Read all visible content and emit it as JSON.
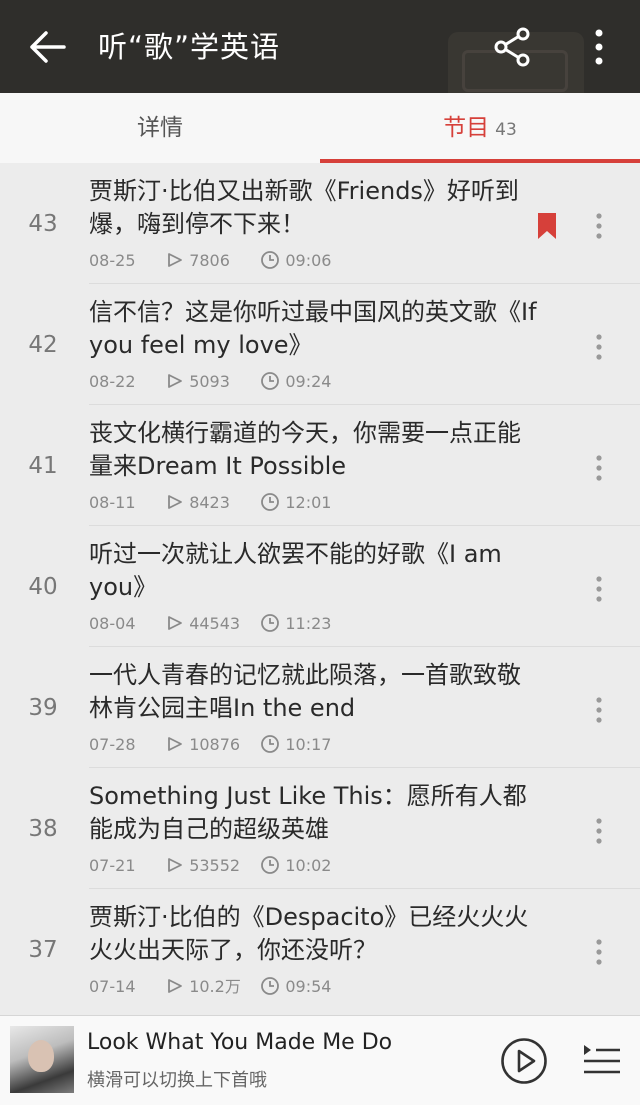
{
  "header": {
    "title": "听“歌”学英语",
    "back_icon": "arrow-left-icon",
    "share_icon": "share-icon",
    "more_icon": "more-vertical-icon"
  },
  "tabs": [
    {
      "label": "详情",
      "count": "",
      "active": false
    },
    {
      "label": "节目",
      "count": "43",
      "active": true
    }
  ],
  "episodes": [
    {
      "num": "43",
      "title": "贾斯汀·比伯又出新歌《Friends》好听到爆，嗨到停不下来！",
      "date": "08-25",
      "plays": "7806",
      "duration": "09:06",
      "bookmarked": true
    },
    {
      "num": "42",
      "title": "信不信？这是你听过最中国风的英文歌《If you feel my love》",
      "date": "08-22",
      "plays": "5093",
      "duration": "09:24",
      "bookmarked": false
    },
    {
      "num": "41",
      "title": "丧文化横行霸道的今天，你需要一点正能量来Dream It Possible",
      "date": "08-11",
      "plays": "8423",
      "duration": "12:01",
      "bookmarked": false
    },
    {
      "num": "40",
      "title": "听过一次就让人欲罢不能的好歌《I am you》",
      "date": "08-04",
      "plays": "44543",
      "duration": "11:23",
      "bookmarked": false
    },
    {
      "num": "39",
      "title": "一代人青春的记忆就此陨落，一首歌致敬林肯公园主唱In the end",
      "date": "07-28",
      "plays": "10876",
      "duration": "10:17",
      "bookmarked": false
    },
    {
      "num": "38",
      "title": "Something Just Like This：愿所有人都能成为自己的超级英雄",
      "date": "07-21",
      "plays": "53552",
      "duration": "10:02",
      "bookmarked": false
    },
    {
      "num": "37",
      "title": "贾斯汀·比伯的《Despacito》已经火火火火火出天际了，你还没听？",
      "date": "07-14",
      "plays": "10.2万",
      "duration": "09:54",
      "bookmarked": false
    }
  ],
  "player": {
    "song_title": "Look What You Made Me Do",
    "hint": "横滑可以切换上下首哦",
    "play_icon": "play-circle-icon",
    "queue_icon": "playlist-icon"
  },
  "colors": {
    "accent": "#d6403a",
    "header_bg": "#2f2e2b",
    "list_bg": "#ececec"
  }
}
